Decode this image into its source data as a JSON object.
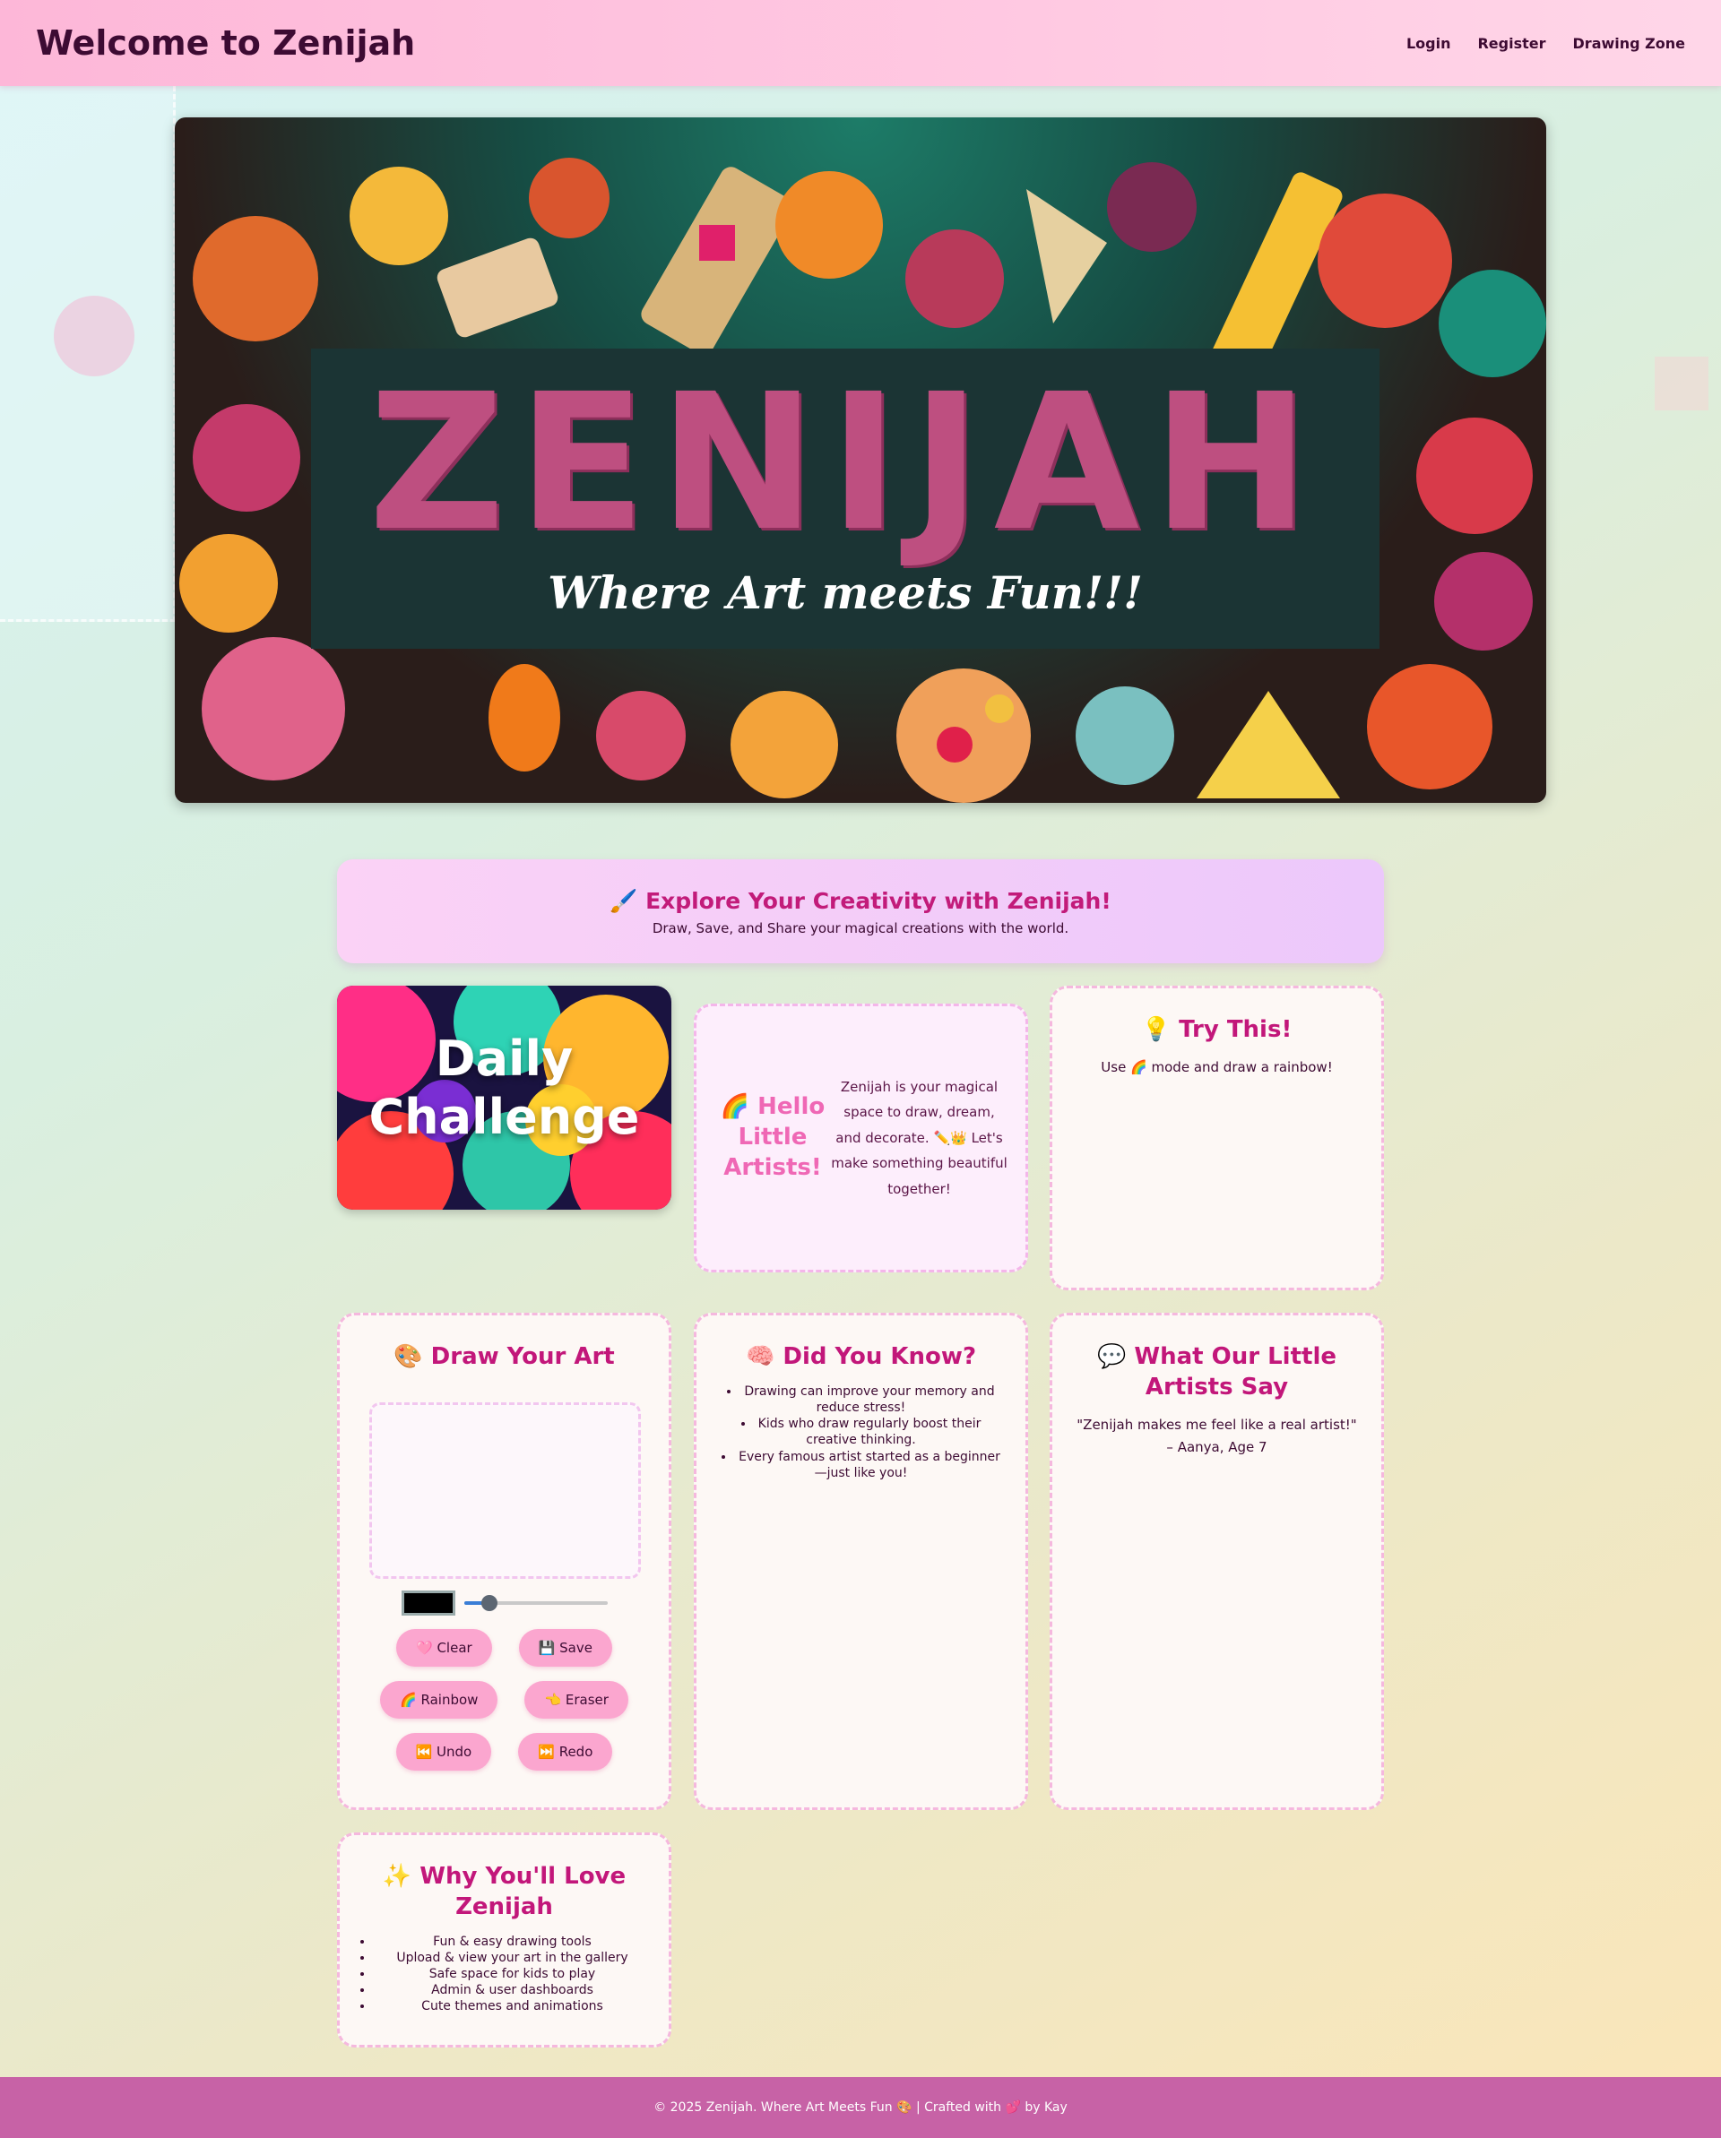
{
  "header": {
    "title": "Welcome to Zenijah",
    "nav": [
      "Login",
      "Register",
      "Drawing Zone"
    ]
  },
  "banner": {
    "title": "ZENIJAH",
    "tagline": "Where Art meets Fun!!!"
  },
  "intro": {
    "title": "🖌️ Explore Your Creativity with Zenijah!",
    "subtitle": "Draw, Save, and Share your magical creations with the world."
  },
  "challenge": {
    "label": "Daily Challenge"
  },
  "hello": {
    "title": "🌈 Hello Little Artists!",
    "text": "Zenijah is your magical space to draw, dream, and decorate. ✏️👑 Let's make something beautiful together!"
  },
  "try_this": {
    "title": "💡 Try This!",
    "text": "Use 🌈 mode and draw a rainbow!"
  },
  "draw": {
    "title": "🎨 Draw Your Art",
    "brush_color": "#000000",
    "brush_size_fraction": 0.18,
    "buttons": {
      "clear": "🩷 Clear",
      "save": "💾 Save",
      "rainbow": "🌈 Rainbow",
      "eraser": "👈 Eraser",
      "undo": "⏮️ Undo",
      "redo": "⏭️ Redo"
    }
  },
  "did_you_know": {
    "title": "🧠 Did You Know?",
    "items": [
      "Drawing can improve your memory and reduce stress!",
      "Kids who draw regularly boost their creative thinking.",
      "Every famous artist started as a beginner—just like you!"
    ]
  },
  "testimonial": {
    "title": "💬 What Our Little Artists Say",
    "quote": "\"Zenijah makes me feel like a real artist!\"",
    "author": "– Aanya, Age 7"
  },
  "why_love": {
    "title": "✨ Why You'll Love Zenijah",
    "items": [
      "Fun & easy drawing tools",
      "Upload & view your art in the gallery",
      "Safe space for kids to play",
      "Admin & user dashboards",
      "Cute themes and animations"
    ]
  },
  "footer": {
    "text": "© 2025 Zenijah. Where Art Meets Fun 🎨 | Crafted with 💕 by Kay"
  },
  "colors": {
    "header_pink": "#fdb7d8",
    "accent_magenta": "#c2177a",
    "banner_title": "#be4f80",
    "footer": "#c762a6"
  }
}
